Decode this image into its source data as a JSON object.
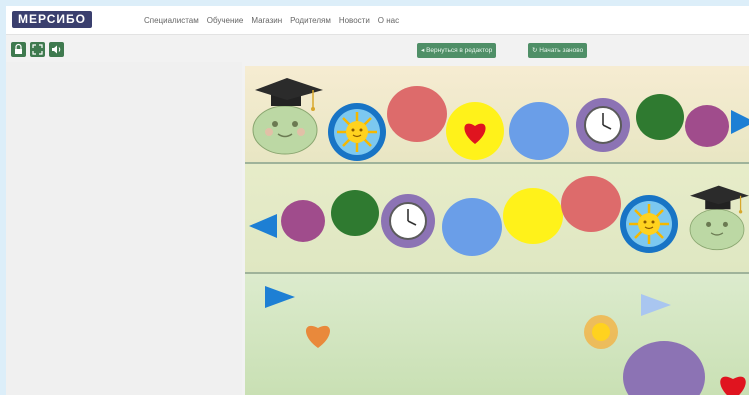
{
  "header": {
    "logo_text": "МЕРСИБО",
    "nav": [
      {
        "label": "Специалистам"
      },
      {
        "label": "Обучение"
      },
      {
        "label": "Магазин"
      },
      {
        "label": "Родителям"
      },
      {
        "label": "Новости"
      },
      {
        "label": "О нас"
      }
    ]
  },
  "toolbar": {
    "icons": [
      "lock-icon",
      "fullscreen-icon",
      "sound-icon"
    ],
    "back_to_editor_label": "Вернуться в редактор",
    "restart_label": "Начать заново"
  },
  "colors": {
    "logo_bg": "#3a3f6e",
    "button_green": "#4f8f67",
    "board_row1": "#f6ecd2",
    "board_row2": "#e7ecc9",
    "board_row3": "#dcebcd",
    "red_circle": "#dd6b6b",
    "blue_circle": "#6a9ee8",
    "green_circle": "#2f7a30",
    "purple_circle": "#a04c8c",
    "yellow_circle": "#fff21a",
    "arrow_blue": "#1d7fd4"
  },
  "board": {
    "row1_items": [
      "character-in-graduation-cap",
      "sun-in-blue-circle",
      "red-circle",
      "heart-in-yellow-circle",
      "blue-circle",
      "clock-in-purple-circle",
      "green-circle",
      "purple-circle",
      "arrow-right"
    ],
    "row2_items": [
      "arrow-left",
      "purple-circle",
      "green-circle",
      "clock-in-purple-circle",
      "blue-circle",
      "yellow-circle",
      "red-circle",
      "sun-in-blue-circle",
      "character-in-graduation-cap"
    ],
    "row3_items": [
      "arrow-right",
      "orange-heart",
      "sun-small",
      "light-blue-arrow",
      "lavender-circle",
      "red-heart"
    ]
  }
}
